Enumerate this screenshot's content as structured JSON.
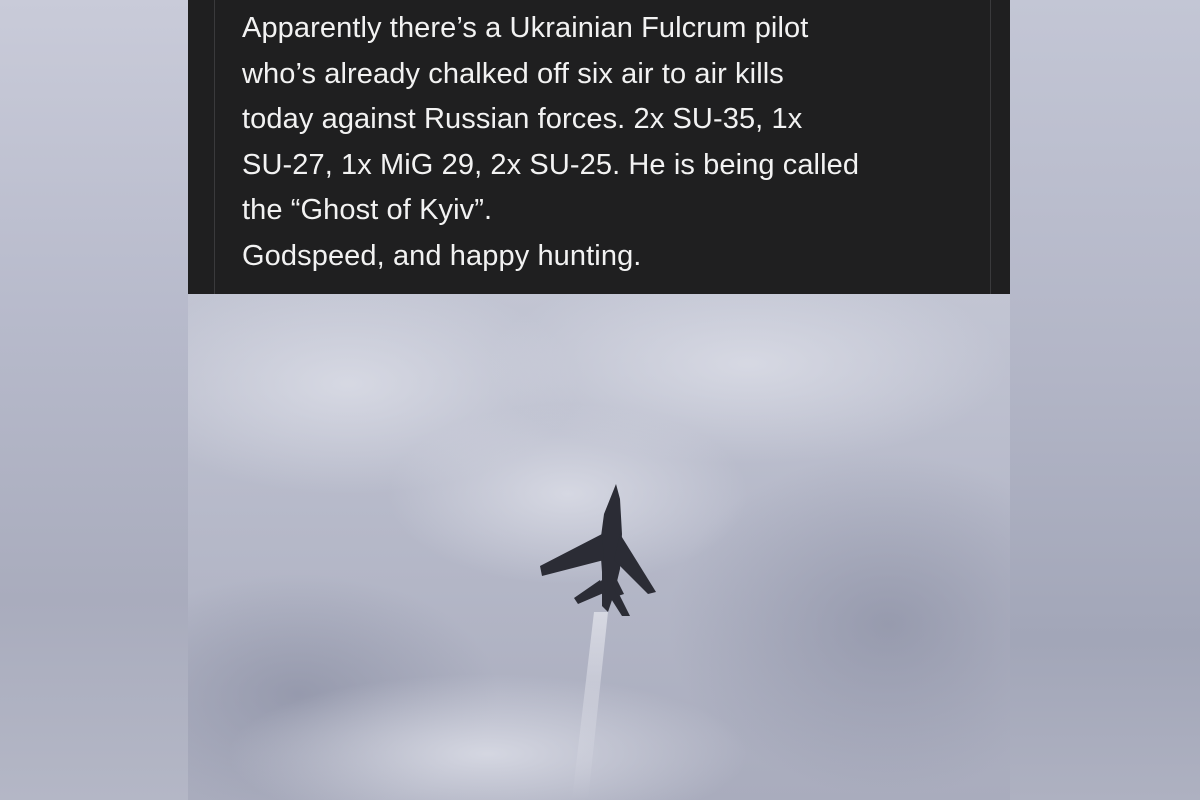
{
  "post": {
    "lines": [
      "Apparently there’s a Ukrainian Fulcrum pilot",
      "who’s already chalked off six air to air kills",
      "today against Russian forces. 2x SU-35, 1x",
      "SU-27, 1x MiG 29, 2x SU-25. He is being called",
      "the “Ghost of Kyiv”.",
      "Godspeed, and happy hunting."
    ]
  },
  "colors": {
    "panel_background": "#1f1f20",
    "text": "#f2f2f2",
    "sky": "#b9bccb",
    "aircraft": "#2b2c35"
  }
}
